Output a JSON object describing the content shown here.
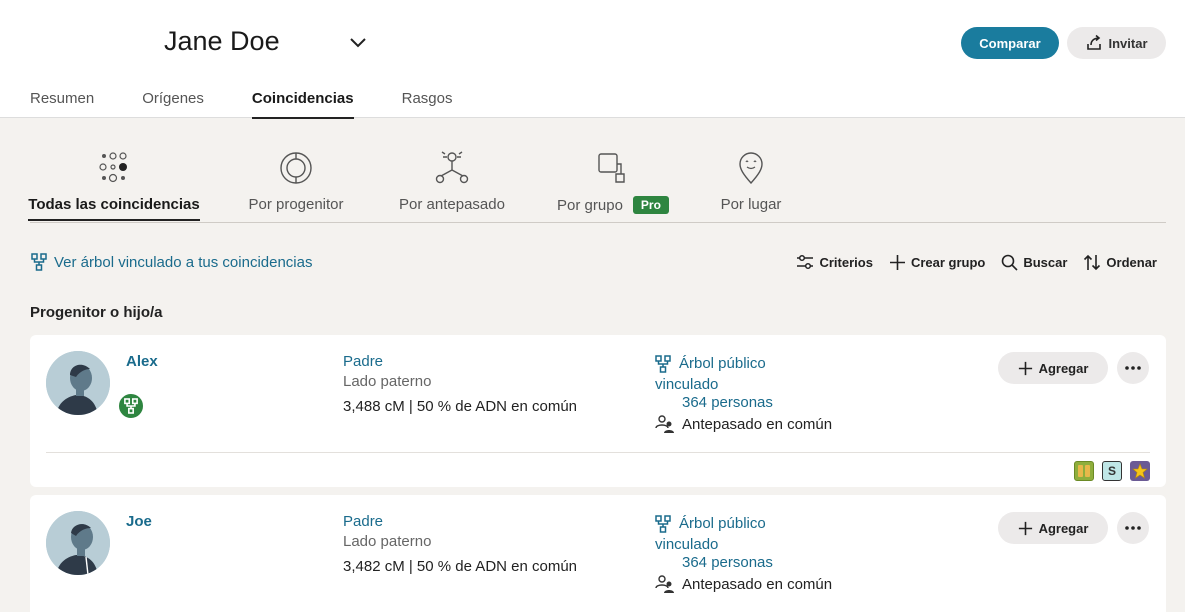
{
  "header": {
    "person_name": "Jane Doe",
    "compare_label": "Comparar",
    "invite_label": "Invitar",
    "tabs": [
      {
        "label": "Resumen"
      },
      {
        "label": "Orígenes"
      },
      {
        "label": "Coincidencias",
        "active": true
      },
      {
        "label": "Rasgos"
      }
    ]
  },
  "subnav": {
    "items": [
      {
        "label": "Todas las coincidencias",
        "icon": "dots-grid-icon",
        "active": true
      },
      {
        "label": "Por progenitor",
        "icon": "parent-circle-icon"
      },
      {
        "label": "Por antepasado",
        "icon": "ancestor-tree-icon"
      },
      {
        "label": "Por grupo",
        "icon": "group-squares-icon",
        "badge": "Pro"
      },
      {
        "label": "Por lugar",
        "icon": "location-pin-icon"
      }
    ]
  },
  "toolbar": {
    "tree_link": "Ver árbol vinculado a tus coincidencias",
    "criteria": "Criterios",
    "create_group": "Crear grupo",
    "search": "Buscar",
    "sort": "Ordenar"
  },
  "section_title": "Progenitor o hijo/a",
  "matches": [
    {
      "name": "Alex",
      "relationship": "Padre",
      "side": "Lado paterno",
      "dna": "3,488 cM | 50 % de ADN en común",
      "tree_line1": "Árbol público",
      "tree_line2": "vinculado",
      "people": "364 personas",
      "ancestor": "Antepasado en común",
      "add_label": "Agregar",
      "tags": [
        "S"
      ]
    },
    {
      "name": "Joe",
      "relationship": "Padre",
      "side": "Lado paterno",
      "dna": "3,482 cM | 50 % de ADN en común",
      "tree_line1": "Árbol público",
      "tree_line2": "vinculado",
      "people": "364 personas",
      "ancestor": "Antepasado en común",
      "add_label": "Agregar"
    }
  ],
  "colors": {
    "accent": "#1a7c9e",
    "link": "#1a6b8c",
    "pro_badge": "#2e8540",
    "background": "#f4f2ef"
  }
}
